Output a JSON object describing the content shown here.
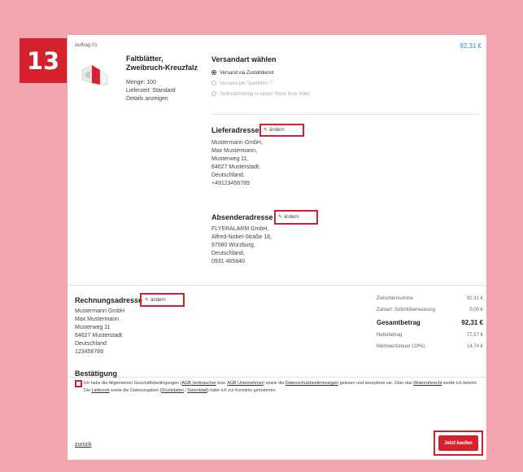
{
  "step_number": "13",
  "order": {
    "label": "Auftrag 01",
    "price": "92,31 €",
    "product": {
      "title_line1": "Faltblätter,",
      "title_line2": "Zweibruch-Kreuzfalz",
      "quantity": "Menge: 100",
      "delivery": "Lieferzeit: Standard",
      "details_link": "Details anzeigen"
    }
  },
  "shipping": {
    "heading": "Versandart wählen",
    "options": [
      {
        "label": "Versand via Zustelldienst",
        "selected": true
      },
      {
        "label": "Versand per Spedition ⓘ",
        "selected": false
      },
      {
        "label": "Selbstabholung in einem Store Ihrer Wahl",
        "selected": false
      }
    ]
  },
  "delivery_address": {
    "heading": "Lieferadresse",
    "edit_label": "ändern",
    "lines": [
      "Mustermann GmbH,",
      "Max Mustermann,",
      "Musterweg 11,",
      "64627 Musterstadt,",
      "Deutschland,",
      "+49123456789"
    ]
  },
  "sender_address": {
    "heading": "Absenderadresse",
    "edit_label": "ändern",
    "lines": [
      "FLYERALARM GmbH,",
      "Alfred-Nobel-Straße 18,",
      "97080 Würzburg,",
      "Deutschland,",
      "0931 465840"
    ]
  },
  "billing_address": {
    "heading": "Rechnungsadresse",
    "edit_label": "ändern",
    "lines": [
      "Mustermann GmbH",
      "Max Mustermann",
      "Musterweg 11",
      "64627 Musterstadt",
      "Deutschland",
      "123456789"
    ]
  },
  "summary": {
    "subtotal_label": "Zwischensumme",
    "subtotal_value": "92,31 €",
    "payment_label": "Zahlart: Sofortüberweisung",
    "payment_value": "0,00 €",
    "total_label": "Gesamtbetrag",
    "total_value": "92,31 €",
    "net_label": "Nettobetrag",
    "net_value": "77,57 €",
    "vat_label": "Mehrwertsteuer (19%)",
    "vat_value": "14,74 €"
  },
  "confirmation": {
    "heading": "Bestätigung",
    "text_1": "Ich habe die Allgemeinen Geschäftsbedingungen (",
    "agb_consumer": "AGB Verbraucher",
    "text_2": " bzw. ",
    "agb_business": "AGB Unternehmer",
    "text_3": ") sowie die ",
    "privacy": "Datenschutzbestimmungen",
    "text_4": " gelesen und akzeptiere sie. Über das ",
    "withdrawal": "Widerrufsrecht",
    "text_5": " wurde ich belehrt. Die ",
    "delivery_time": "Lieferzeit",
    "text_6": " sowie die Dateivorgaben (",
    "print_data": "Druckdaten",
    "text_7": " / ",
    "datasheet": "Datenblatt",
    "text_8": ") habe ich zur Kenntnis genommen."
  },
  "back_link": "zurück",
  "buy_button": "Jetzt kaufen",
  "colors": {
    "accent": "#d5202e",
    "background": "#f2a5ae",
    "price": "#1e88c8"
  }
}
